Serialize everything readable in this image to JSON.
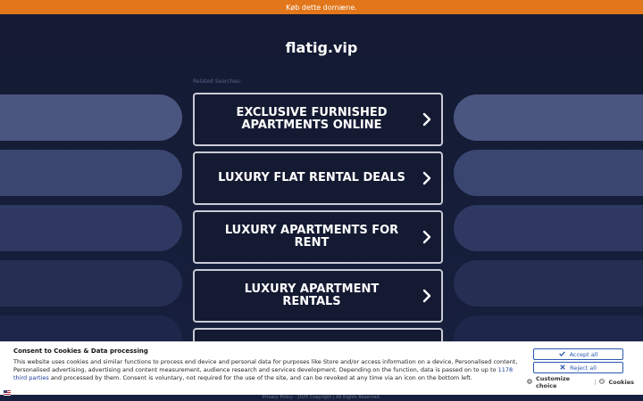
{
  "banner": {
    "text": "Køb dette domæne."
  },
  "site": {
    "title": "flatig.vip",
    "related_label": "Related Searches:"
  },
  "searches": [
    {
      "label": "EXCLUSIVE FURNISHED APARTMENTS ONLINE"
    },
    {
      "label": "LUXURY FLAT RENTAL DEALS"
    },
    {
      "label": "LUXURY APARTMENTS FOR RENT"
    },
    {
      "label": "LUXURY APARTMENT RENTALS"
    },
    {
      "label": ""
    }
  ],
  "footer": {
    "text": "Privacy Policy  ·  2025 Copyright | All Rights Reserved."
  },
  "consent": {
    "title": "Consent to Cookies & Data processing",
    "text_before": "This website uses cookies and similar functions to process end device and personal data for purposes like Store and/or access information on a device, Personalised content, Personalised advertising, advertising and content measurement, audience research and services development. Depending on the function, data is passed on to up to ",
    "link_text": "1178 third parties",
    "text_after": " and processed by them. Consent is voluntary, not required for the use of the site, and can be revoked at any time via an icon on the bottom left.",
    "accept_label": "Accept all",
    "reject_label": "Reject all",
    "customize_label": "Customize choice",
    "separator": "|",
    "cookies_label": "Cookies"
  },
  "colors": {
    "banner": "#e2761b",
    "background": "#141a32",
    "pill_top": "#4a5580",
    "pill_bottom": "#1d2545",
    "button_border": "#c9cbd6",
    "consent_accent": "#2b58b3"
  },
  "icons": {
    "chevron": "chevron-right-icon",
    "check": "check-icon",
    "close": "close-icon",
    "gear": "gear-icon",
    "cookie": "cookie-icon",
    "flag": "us-flag-icon"
  }
}
